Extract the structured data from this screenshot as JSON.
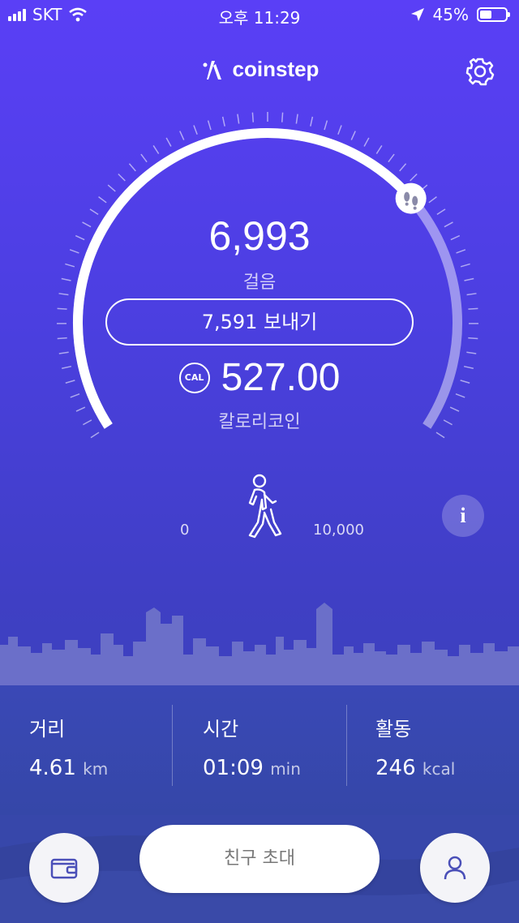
{
  "status_bar": {
    "carrier": "SKT",
    "time": "오후 11:29",
    "battery": "45%",
    "battery_level": 0.45
  },
  "header": {
    "app_name": "coinstep",
    "icons": [
      "coinstep-logo-icon",
      "gear-icon"
    ]
  },
  "gauge": {
    "steps": "6,993",
    "steps_label": "걸음",
    "send_button": "7,591 보내기",
    "coins": "527.00",
    "coin_badge": "CAL",
    "coin_label": "칼로리코인",
    "min": "0",
    "max": "10,000",
    "progress": 0.6993,
    "marker_icon": "footprints-icon",
    "center_icon": "walking-person-icon",
    "info_label": "i"
  },
  "stats": [
    {
      "label": "거리",
      "value": "4.61",
      "unit": "km"
    },
    {
      "label": "시간",
      "value": "01:09",
      "unit": "min"
    },
    {
      "label": "활동",
      "value": "246",
      "unit": "kcal"
    }
  ],
  "bottom_bar": {
    "invite_label": "친구 초대",
    "icons": [
      "wallet-icon",
      "profile-icon"
    ]
  },
  "colors": {
    "bg_top": "#5a3ff6",
    "bg_bottom": "#3847b0",
    "panel": "#3747aa"
  }
}
